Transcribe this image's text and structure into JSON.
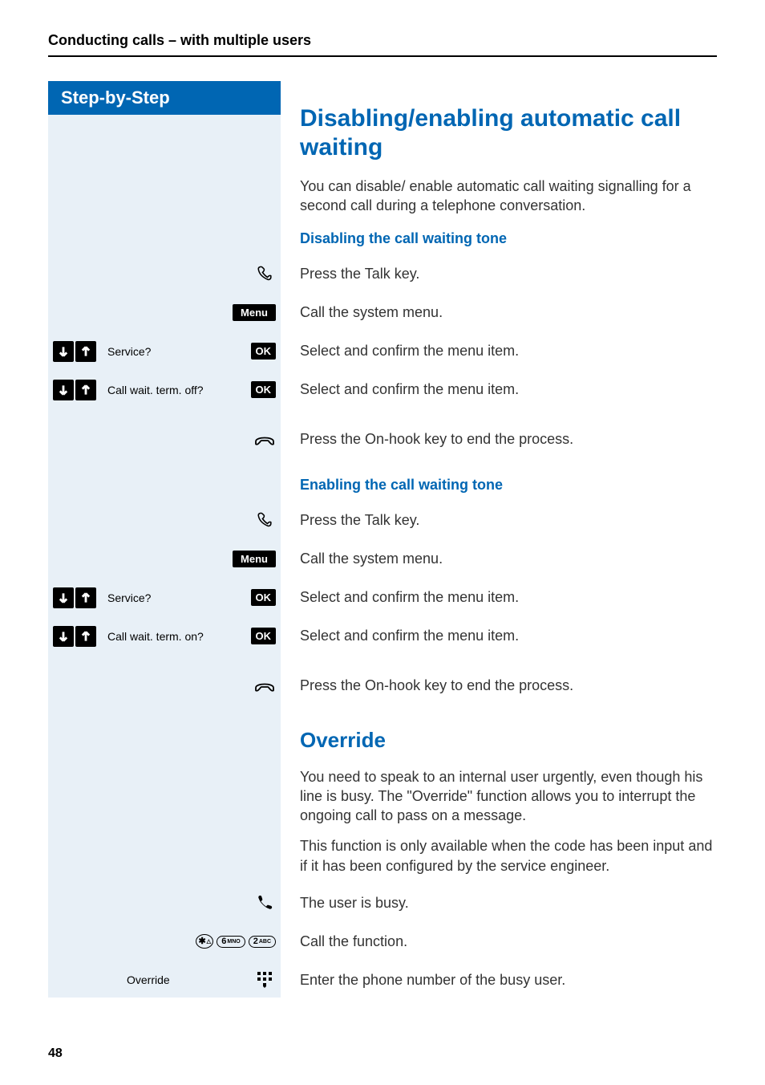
{
  "header": "Conducting calls – with multiple users",
  "sidebar_title": "Step-by-Step",
  "section1": {
    "title": "Disabling/enabling automatic call waiting",
    "intro": "You can disable/ enable automatic call waiting signalling for a second call during a telephone conversation.",
    "sub_disable": "Disabling the call waiting tone",
    "sub_enable": "Enabling the call waiting tone"
  },
  "steps": {
    "press_talk": "Press the Talk key.",
    "call_system": "Call the system menu.",
    "select_confirm": "Select and confirm the menu item.",
    "press_onhook": "Press the On-hook key to end the process."
  },
  "labels": {
    "menu": "Menu",
    "ok": "OK",
    "service": "Service?",
    "cw_off": "Call wait. term. off?",
    "cw_on": "Call wait. term. on?",
    "override": "Override"
  },
  "section2": {
    "title": "Override",
    "p1": "You need to speak to an internal user urgently, even though his line is busy. The \"Override\" function allows you to interrupt the ongoing call to pass on a message.",
    "p2": "This function is only available when the code has been input and if it has been configured by the service engineer.",
    "busy": "The user is busy.",
    "call_fn": "Call the function.",
    "enter_num": "Enter the phone number of the busy user."
  },
  "keys": {
    "star": "✱",
    "k6": "6",
    "k6s": "MNO",
    "k2": "2",
    "k2s": "ABC"
  },
  "page_number": "48"
}
